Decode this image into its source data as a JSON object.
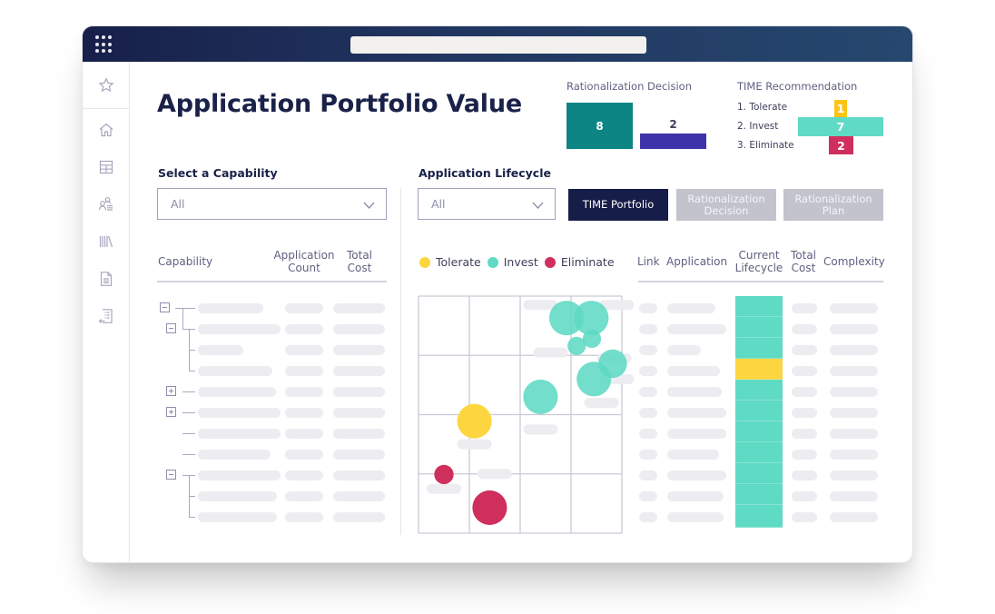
{
  "window": {
    "address_bar_value": ""
  },
  "sidebar": {
    "items": [
      {
        "name": "favorites",
        "icon": "star-icon"
      },
      {
        "name": "home",
        "icon": "home-icon"
      },
      {
        "name": "table",
        "icon": "table-icon"
      },
      {
        "name": "users",
        "icon": "users-list-icon"
      },
      {
        "name": "library",
        "icon": "library-icon"
      },
      {
        "name": "document",
        "icon": "document-icon"
      },
      {
        "name": "import",
        "icon": "import-list-icon"
      }
    ]
  },
  "page": {
    "title": "Application Portfolio Value"
  },
  "rationalization_decision": {
    "label": "Rationalization Decision",
    "bars": [
      {
        "value": "8",
        "color": "#0e8585"
      },
      {
        "value": "2",
        "color": "#3c34a8"
      }
    ]
  },
  "time_recommendation": {
    "label": "TIME Recommendation",
    "rows": [
      {
        "label": "1. Tolerate",
        "value": "1",
        "color": "#fdc513"
      },
      {
        "label": "2. Invest",
        "value": "7",
        "color": "#5fdac4"
      },
      {
        "label": "3. Eliminate",
        "value": "2",
        "color": "#cf2f5c"
      }
    ]
  },
  "capability": {
    "label": "Select a Capability",
    "select_value": "All",
    "columns": [
      "Capability",
      "Application Count",
      "Total Cost"
    ]
  },
  "lifecycle": {
    "label": "Application Lifecycle",
    "select_value": "All",
    "tabs": [
      {
        "label": "TIME Portfolio",
        "active": true
      },
      {
        "label": "Rationalization Decision",
        "active": false
      },
      {
        "label": "Rationalization Plan",
        "active": false
      }
    ],
    "legend": [
      {
        "label": "Tolerate",
        "color": "#fdd63f"
      },
      {
        "label": "Invest",
        "color": "#5fdac4"
      },
      {
        "label": "Eliminate",
        "color": "#cf2f5c"
      }
    ],
    "table_columns": [
      "Link",
      "Application",
      "Current Lifecycle",
      "Total Cost",
      "Complexity"
    ],
    "current_lifecycle_rows": [
      "Invest",
      "Invest",
      "Invest",
      "Tolerate",
      "Invest",
      "Invest",
      "Invest",
      "Invest",
      "Invest",
      "Invest",
      "Invest"
    ]
  },
  "chart_data": {
    "type": "scatter",
    "title": "",
    "xlabel": "",
    "ylabel": "",
    "grid": true,
    "xlim": [
      0,
      4
    ],
    "ylim": [
      0,
      4
    ],
    "series": [
      {
        "name": "Invest",
        "color": "#5fdac4",
        "points": [
          {
            "x": 2.91,
            "y": 3.63,
            "r": 0.34
          },
          {
            "x": 3.4,
            "y": 3.63,
            "r": 0.34
          },
          {
            "x": 3.11,
            "y": 3.16,
            "r": 0.18
          },
          {
            "x": 3.41,
            "y": 3.28,
            "r": 0.18
          },
          {
            "x": 3.82,
            "y": 2.86,
            "r": 0.28
          },
          {
            "x": 3.45,
            "y": 2.6,
            "r": 0.34
          },
          {
            "x": 2.4,
            "y": 2.3,
            "r": 0.34
          }
        ]
      },
      {
        "name": "Tolerate",
        "color": "#fdd63f",
        "points": [
          {
            "x": 1.1,
            "y": 1.89,
            "r": 0.34
          }
        ]
      },
      {
        "name": "Eliminate",
        "color": "#cf2f5c",
        "points": [
          {
            "x": 0.5,
            "y": 0.99,
            "r": 0.19
          },
          {
            "x": 1.4,
            "y": 0.43,
            "r": 0.34
          }
        ]
      }
    ]
  }
}
